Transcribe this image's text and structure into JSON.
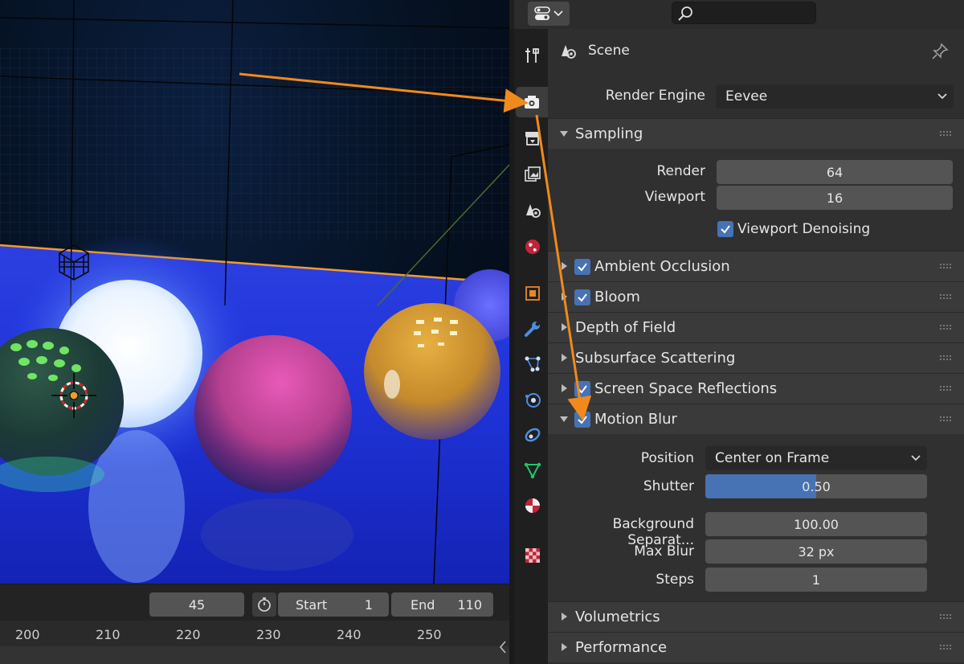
{
  "properties": {
    "header": {
      "search_placeholder": ""
    },
    "context_title": "Scene",
    "render_engine": {
      "label": "Render Engine",
      "value": "Eevee"
    },
    "sampling": {
      "title": "Sampling",
      "render_label": "Render",
      "render_value": "64",
      "viewport_label": "Viewport",
      "viewport_value": "16",
      "denoise_label": "Viewport Denoising"
    },
    "sections": [
      {
        "title": "Ambient Occlusion",
        "checked": true
      },
      {
        "title": "Bloom",
        "checked": true
      },
      {
        "title": "Depth of Field",
        "checked": false
      },
      {
        "title": "Subsurface Scattering",
        "checked": false
      },
      {
        "title": "Screen Space Reflections",
        "checked": true
      }
    ],
    "motion_blur": {
      "title": "Motion Blur",
      "position_label": "Position",
      "position_value": "Center on Frame",
      "shutter_label": "Shutter",
      "shutter_value": "0.50",
      "shutter_fraction": 0.5,
      "bg_sep_label": "Background Separat...",
      "bg_sep_value": "100.00",
      "max_blur_label": "Max Blur",
      "max_blur_value": "32 px",
      "steps_label": "Steps",
      "steps_value": "1"
    },
    "volumetrics_title": "Volumetrics",
    "performance_title": "Performance"
  },
  "timeline": {
    "current_frame": "45",
    "start_label": "Start",
    "start_value": "1",
    "end_label": "End",
    "end_value": "110",
    "ticks": [
      "200",
      "210",
      "220",
      "230",
      "240",
      "250"
    ]
  },
  "colors": {
    "accent": "#4772b3",
    "annotation_arrow": "#f08a1c",
    "selected_outline": "#f29b2e"
  }
}
